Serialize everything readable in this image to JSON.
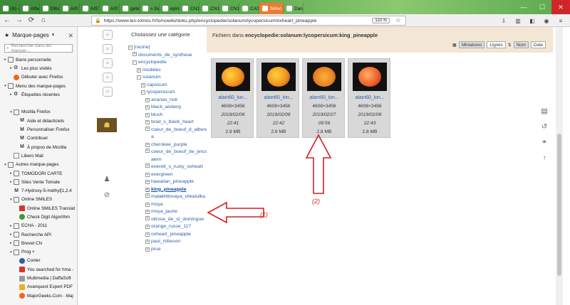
{
  "browser": {
    "tabs": [
      {
        "label": "(6) -"
      },
      {
        "label": "Alfas"
      },
      {
        "label": "Dibu"
      },
      {
        "label": "AIST:Spec"
      },
      {
        "label": "AIST:Spec"
      },
      {
        "label": "AIST:Spec"
      },
      {
        "label": "gete"
      },
      {
        "label": "« Des"
      },
      {
        "label": "epine"
      },
      {
        "label": "CN10"
      },
      {
        "label": "CN10"
      },
      {
        "label": "CN10"
      },
      {
        "label": "CAS"
      },
      {
        "label": "Sélec"
      },
      {
        "label": "Dans"
      }
    ],
    "url": "https://www.les-tomos.fr/tomowiki/doku.php/encyclopedie/solanum/lycopersicum/oxheart_pineapple",
    "zoom": "110 %"
  },
  "sidebar": {
    "title": "Marque-pages",
    "search_placeholder": "Rechercher dans les marque-...",
    "items": [
      {
        "label": "Barre personnelle",
        "level": 0,
        "toggle": "▸",
        "icon": "folder"
      },
      {
        "label": "Les plus visités",
        "level": 1,
        "toggle": "▸",
        "icon": "gear"
      },
      {
        "label": "Débuter avec Firefox",
        "level": 1,
        "toggle": "",
        "icon": "orange"
      },
      {
        "label": "Menu des marque-pages",
        "level": 0,
        "toggle": "▾",
        "icon": "folder"
      },
      {
        "label": "Étiquettes récentes",
        "level": 1,
        "toggle": "▸",
        "icon": "gear"
      },
      {
        "label": "",
        "level": 0,
        "toggle": "",
        "icon": "none"
      },
      {
        "label": "Mozilla Firefox",
        "level": 1,
        "toggle": "▾",
        "icon": "folder"
      },
      {
        "label": "Aide et didacticiels",
        "level": 2,
        "toggle": "",
        "icon": "m"
      },
      {
        "label": "Personnaliser Firefox",
        "level": 2,
        "toggle": "",
        "icon": "m"
      },
      {
        "label": "Contribuer",
        "level": 2,
        "toggle": "",
        "icon": "m"
      },
      {
        "label": "À propos de Mozilla",
        "level": 2,
        "toggle": "",
        "icon": "m"
      },
      {
        "label": "Libero Mail",
        "level": 1,
        "toggle": "",
        "icon": "page"
      },
      {
        "label": "Autres marque-pages",
        "level": 0,
        "toggle": "▾",
        "icon": "folder"
      },
      {
        "label": "TOMODORI CARTE",
        "level": 1,
        "toggle": "▸",
        "icon": "folder"
      },
      {
        "label": "Sites Vente Tomate",
        "level": 1,
        "toggle": "▸",
        "icon": "folder"
      },
      {
        "label": "7-Hydroxy-5-methyl[1,2,4",
        "level": 1,
        "toggle": "",
        "icon": "m"
      },
      {
        "label": "Online SMILES",
        "level": 1,
        "toggle": "▾",
        "icon": "folder"
      },
      {
        "label": "Online SMILES Translat",
        "level": 2,
        "toggle": "",
        "icon": "red"
      },
      {
        "label": "Check Digit Algorithm",
        "level": 2,
        "toggle": "",
        "icon": "green"
      },
      {
        "label": "ECHA - 2011",
        "level": 1,
        "toggle": "▸",
        "icon": "folder"
      },
      {
        "label": "Recherche API",
        "level": 1,
        "toggle": "▸",
        "icon": "folder"
      },
      {
        "label": "Brevet CN",
        "level": 1,
        "toggle": "▸",
        "icon": "folder"
      },
      {
        "label": "Prog +",
        "level": 1,
        "toggle": "▾",
        "icon": "folder"
      },
      {
        "label": "Cooler",
        "level": 2,
        "toggle": "",
        "icon": "blue"
      },
      {
        "label": "You searched for hma -",
        "level": 2,
        "toggle": "",
        "icon": "red"
      },
      {
        "label": "Multimedia | DaffaSoft",
        "level": 2,
        "toggle": "",
        "icon": "grey"
      },
      {
        "label": "Avanquest Expert PDF",
        "level": 2,
        "toggle": "",
        "icon": "yellow"
      },
      {
        "label": "MajorGeeks.Com - Maj",
        "level": 2,
        "toggle": "",
        "icon": "orange"
      }
    ]
  },
  "category_panel": {
    "heading": "Choisissez une catégorie",
    "tree": [
      {
        "label": "[racine]",
        "indent": 0,
        "toggle": "−"
      },
      {
        "label": "documents_de_synthese",
        "indent": 1,
        "toggle": "+"
      },
      {
        "label": "encyclopedie",
        "indent": 1,
        "toggle": "−"
      },
      {
        "label": "modeles",
        "indent": 2,
        "toggle": "+"
      },
      {
        "label": "solanum",
        "indent": 2,
        "toggle": "−"
      },
      {
        "label": "capsicum",
        "indent": 3,
        "toggle": "+"
      },
      {
        "label": "lycopersicum",
        "indent": 3,
        "toggle": "−"
      },
      {
        "label": "ananas_noir",
        "indent": 4,
        "toggle": "+"
      },
      {
        "label": "black_aisberg",
        "indent": 4,
        "toggle": "+"
      },
      {
        "label": "blush",
        "indent": 4,
        "toggle": "+"
      },
      {
        "label": "brad_s_black_heart",
        "indent": 4,
        "toggle": "+"
      },
      {
        "label": "coeur_de_boeuf_d_albenga",
        "indent": 4,
        "toggle": "+"
      },
      {
        "label": "cherokee_purple",
        "indent": 4,
        "toggle": "+"
      },
      {
        "label": "coeur_de_boeuf_de_jerusalem",
        "indent": 4,
        "toggle": "+"
      },
      {
        "label": "everett_s_rusty_oxheart",
        "indent": 4,
        "toggle": "+"
      },
      {
        "label": "evergreen",
        "indent": 4,
        "toggle": "+"
      },
      {
        "label": "hawaiian_pineapple",
        "indent": 4,
        "toggle": "+"
      },
      {
        "label": "king_pineapple",
        "indent": 4,
        "toggle": "+",
        "current": true
      },
      {
        "label": "malakhitovaya_shkatulka",
        "indent": 4,
        "toggle": "+"
      },
      {
        "label": "moya",
        "indent": 4,
        "toggle": "+"
      },
      {
        "label": "moya_jaune",
        "indent": 4,
        "toggle": "+"
      },
      {
        "label": "olirose_de_st_domingue",
        "indent": 4,
        "toggle": "+"
      },
      {
        "label": "orange_russe_117",
        "indent": 4,
        "toggle": "+"
      },
      {
        "label": "oxheart_pineapple",
        "indent": 4,
        "toggle": "+"
      },
      {
        "label": "paul_robeson",
        "indent": 4,
        "toggle": "+"
      },
      {
        "label": "prue",
        "indent": 4,
        "toggle": "+"
      }
    ]
  },
  "files_panel": {
    "title_prefix": "Fichiers dans ",
    "title_path": "encyclopedie:solanum:lycopersicum:king_pineapple",
    "view_miniatures": "Miniatures",
    "view_lignes": "Lignes",
    "sort_nom": "Nom",
    "sort_date": "Date",
    "files": [
      {
        "name": "alain60_kin...",
        "dims": "4608×3456",
        "date": "2019/02/06",
        "time": "22:41",
        "size": "2.9 MB",
        "style": "whole"
      },
      {
        "name": "alain60_kin...",
        "dims": "4608×3456",
        "date": "2019/02/06",
        "time": "22:42",
        "size": "2.6 MB",
        "style": "whole"
      },
      {
        "name": "alain60_kin...",
        "dims": "4608×3456",
        "date": "2019/02/27",
        "time": "09:56",
        "size": "2.8 MB",
        "style": "cut"
      },
      {
        "name": "alain60_kin...",
        "dims": "4608×3456",
        "date": "2019/02/06",
        "time": "22:43",
        "size": "2.8 MB",
        "style": "red"
      }
    ]
  },
  "annotations": {
    "label_1": "(1)",
    "label_2": "(2)",
    "color": "#d02020"
  }
}
